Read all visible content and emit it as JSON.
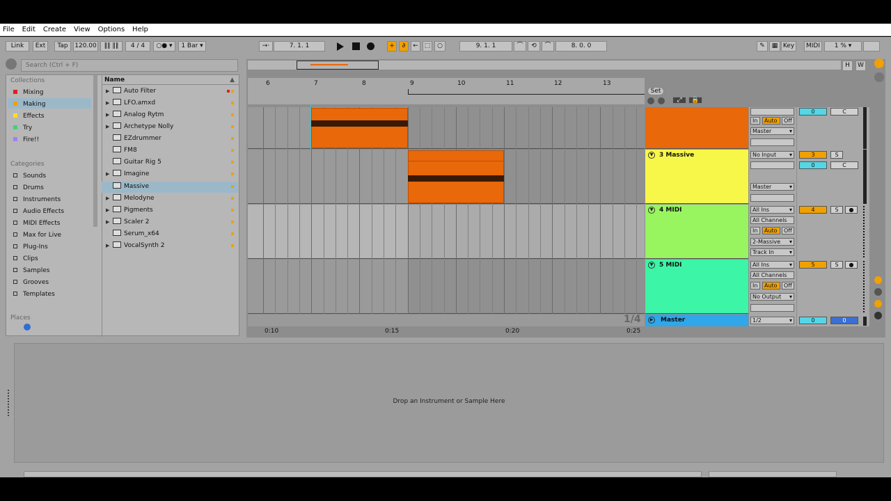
{
  "menu": [
    "File",
    "Edit",
    "Create",
    "View",
    "Options",
    "Help"
  ],
  "transport": {
    "link": "Link",
    "ext": "Ext",
    "tap": "Tap",
    "tempo": "120.00",
    "signature_num": "4",
    "signature_den": "4",
    "quantize": "1 Bar",
    "position": "7.   1.   1",
    "loop_start": "9.   1.   1",
    "loop_length": "8.   0.   0",
    "key": "Key",
    "midi": "MIDI",
    "cpu": "1 %"
  },
  "browser": {
    "search_placeholder": "Search (Ctrl + F)",
    "collections_title": "Collections",
    "collections": [
      {
        "label": "Mixing",
        "color": "#e02020"
      },
      {
        "label": "Making",
        "color": "#f0a000"
      },
      {
        "label": "Effects",
        "color": "#f5e030"
      },
      {
        "label": "Try",
        "color": "#40d080"
      },
      {
        "label": "Fire!!",
        "color": "#a080f0"
      }
    ],
    "categories_title": "Categories",
    "categories": [
      "Sounds",
      "Drums",
      "Instruments",
      "Audio Effects",
      "MIDI Effects",
      "Max for Live",
      "Plug-Ins",
      "Clips",
      "Samples",
      "Grooves",
      "Templates"
    ],
    "places_title": "Places",
    "column_header": "Name",
    "files": [
      {
        "label": "Auto Filter",
        "expandable": true
      },
      {
        "label": "LFO.amxd",
        "expandable": true
      },
      {
        "label": "Analog Rytm",
        "expandable": true
      },
      {
        "label": "Archetype Nolly",
        "expandable": true
      },
      {
        "label": "EZdrummer",
        "expandable": false
      },
      {
        "label": "FM8",
        "expandable": false
      },
      {
        "label": "Guitar Rig 5",
        "expandable": false
      },
      {
        "label": "Imagine",
        "expandable": true
      },
      {
        "label": "Massive",
        "expandable": false
      },
      {
        "label": "Melodyne",
        "expandable": true
      },
      {
        "label": "Pigments",
        "expandable": true
      },
      {
        "label": "Scaler 2",
        "expandable": true
      },
      {
        "label": "Serum_x64",
        "expandable": false
      },
      {
        "label": "VocalSynth 2",
        "expandable": true
      }
    ],
    "selected_file": "Massive"
  },
  "arrangement": {
    "bar_numbers": [
      "6",
      "7",
      "8",
      "9",
      "10",
      "11",
      "12",
      "13"
    ],
    "time_labels": [
      "0:10",
      "0:15",
      "0:20",
      "0:25"
    ],
    "set_label": "Set",
    "zoom_h": "H",
    "zoom_w": "W",
    "fraction": "1/4"
  },
  "tracks": [
    {
      "name": "",
      "color": "#e8680a",
      "in": "",
      "out": "Master",
      "vol": "0",
      "pan": "C"
    },
    {
      "name": "3 Massive",
      "color": "#f7f74a",
      "in": "No Input",
      "out": "Master",
      "num": "3",
      "vol": "0",
      "pan": "C"
    },
    {
      "name": "4 MIDI",
      "color": "#98f560",
      "in": "All Ins",
      "channel": "All Channels",
      "out": "2-Massive",
      "out2": "Track In",
      "num": "4"
    },
    {
      "name": "5 MIDI",
      "color": "#3cf5a6",
      "in": "All Ins",
      "channel": "All Channels",
      "out": "No Output",
      "num": "5"
    }
  ],
  "monitor": {
    "in": "In",
    "auto": "Auto",
    "off": "Off"
  },
  "solo": "S",
  "master": {
    "name": "Master",
    "out": "1/2",
    "vol": "0",
    "vol2": "0",
    "color": "#2fa7e8"
  },
  "detail": {
    "drop_text": "Drop an Instrument or Sample Here"
  },
  "colors": {
    "accent": "#f0a000",
    "clip": "#e8680a"
  }
}
